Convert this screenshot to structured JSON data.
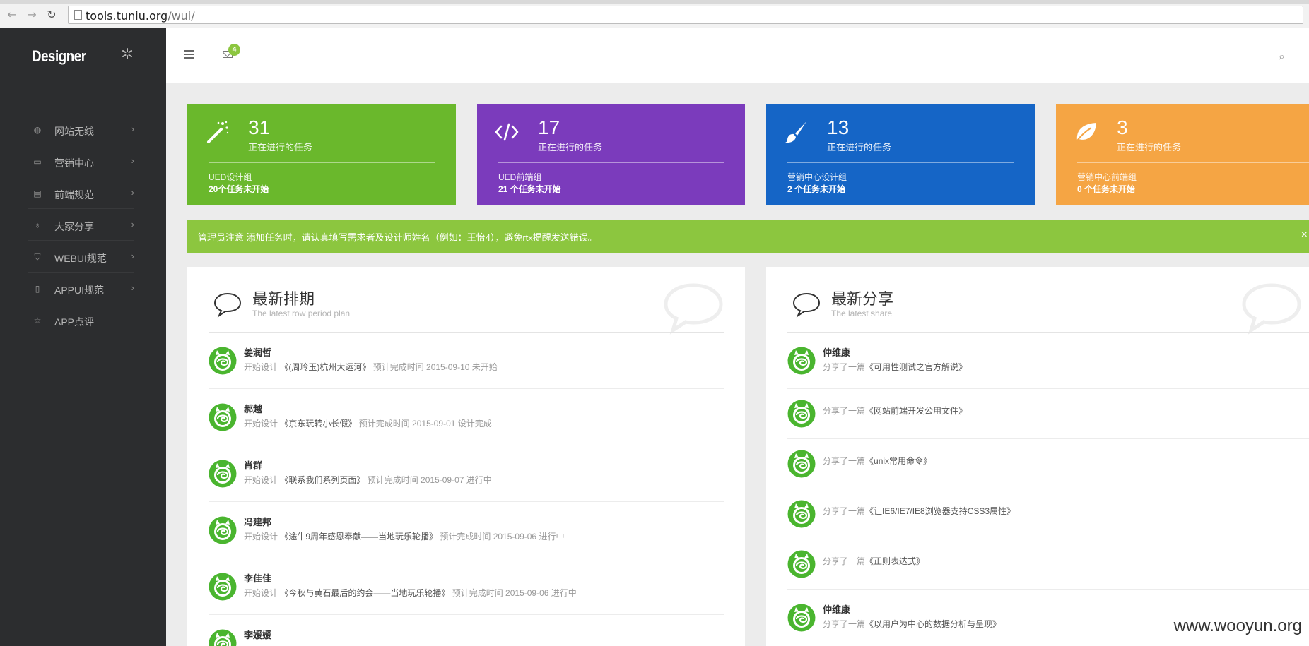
{
  "browser": {
    "url_host": "tools.tuniu.org",
    "url_path": "/wui/"
  },
  "sidebar": {
    "brand": "Designer",
    "items": [
      {
        "label": "网站无线",
        "icon": "globe-icon"
      },
      {
        "label": "营销中心",
        "icon": "inbox-icon"
      },
      {
        "label": "前端规范",
        "icon": "card-icon"
      },
      {
        "label": "大家分享",
        "icon": "lightbulb-icon"
      },
      {
        "label": "WEBUI规范",
        "icon": "shirt-icon"
      },
      {
        "label": "APPUI规范",
        "icon": "mobile-icon"
      },
      {
        "label": "APP点评",
        "icon": "star-icon"
      }
    ]
  },
  "topbar": {
    "mail_badge": "4"
  },
  "stats": [
    {
      "number": "31",
      "subtitle": "正在进行的任务",
      "group": "UED设计组",
      "pending": "20个任务未开始",
      "color": "#6ab82c",
      "icon": "magic-wand-icon"
    },
    {
      "number": "17",
      "subtitle": "正在进行的任务",
      "group": "UED前端组",
      "pending": "21 个任务未开始",
      "color": "#7b3bbc",
      "icon": "code-icon"
    },
    {
      "number": "13",
      "subtitle": "正在进行的任务",
      "group": "营销中心设计组",
      "pending": "2 个任务未开始",
      "color": "#1565c6",
      "icon": "paintbrush-icon"
    },
    {
      "number": "3",
      "subtitle": "正在进行的任务",
      "group": "营销中心前端组",
      "pending": "0 个任务未开始",
      "color": "#f5a544",
      "icon": "leaf-icon"
    }
  ],
  "alert": {
    "text": "管理员注意 添加任务时，请认真填写需求者及设计师姓名（例如：王怡4），避免rtx提醒发送错误。",
    "close": "×"
  },
  "panels": {
    "schedule": {
      "title": "最新排期",
      "subtitle": "The latest row period plan",
      "items": [
        {
          "name": "姜润哲",
          "prefix": "开始设计",
          "work": "《(周玲玉)杭州大运河》",
          "suffix": "预计完成时间 2015-09-10 未开始"
        },
        {
          "name": "郝越",
          "prefix": "开始设计",
          "work": "《京东玩转小长假》",
          "suffix": "预计完成时间 2015-09-01 设计完成"
        },
        {
          "name": "肖群",
          "prefix": "开始设计",
          "work": "《联系我们系列页面》",
          "suffix": "预计完成时间 2015-09-07 进行中"
        },
        {
          "name": "冯建邦",
          "prefix": "开始设计",
          "work": "《途牛9周年感恩奉献——当地玩乐轮播》",
          "suffix": "预计完成时间 2015-09-06 进行中"
        },
        {
          "name": "李佳佳",
          "prefix": "开始设计",
          "work": "《今秋与黄石最后的约会——当地玩乐轮播》",
          "suffix": "预计完成时间 2015-09-06 进行中"
        },
        {
          "name": "李媛媛",
          "prefix": "",
          "work": "",
          "suffix": ""
        }
      ]
    },
    "share": {
      "title": "最新分享",
      "subtitle": "The latest share",
      "items": [
        {
          "name": "仲维康",
          "prefix": "分享了一篇",
          "work": "《可用性测试之官方解说》"
        },
        {
          "name": "",
          "prefix": "分享了一篇",
          "work": "《网站前端开发公用文件》"
        },
        {
          "name": "",
          "prefix": "分享了一篇",
          "work": "《unix常用命令》"
        },
        {
          "name": "",
          "prefix": "分享了一篇",
          "work": "《让IE6/IE7/IE8浏览器支持CSS3属性》"
        },
        {
          "name": "",
          "prefix": "分享了一篇",
          "work": "《正则表达式》"
        },
        {
          "name": "仲维康",
          "prefix": "分享了一篇",
          "work": "《以用户为中心的数据分析与呈现》"
        }
      ]
    }
  },
  "watermark": "www.wooyun.org"
}
